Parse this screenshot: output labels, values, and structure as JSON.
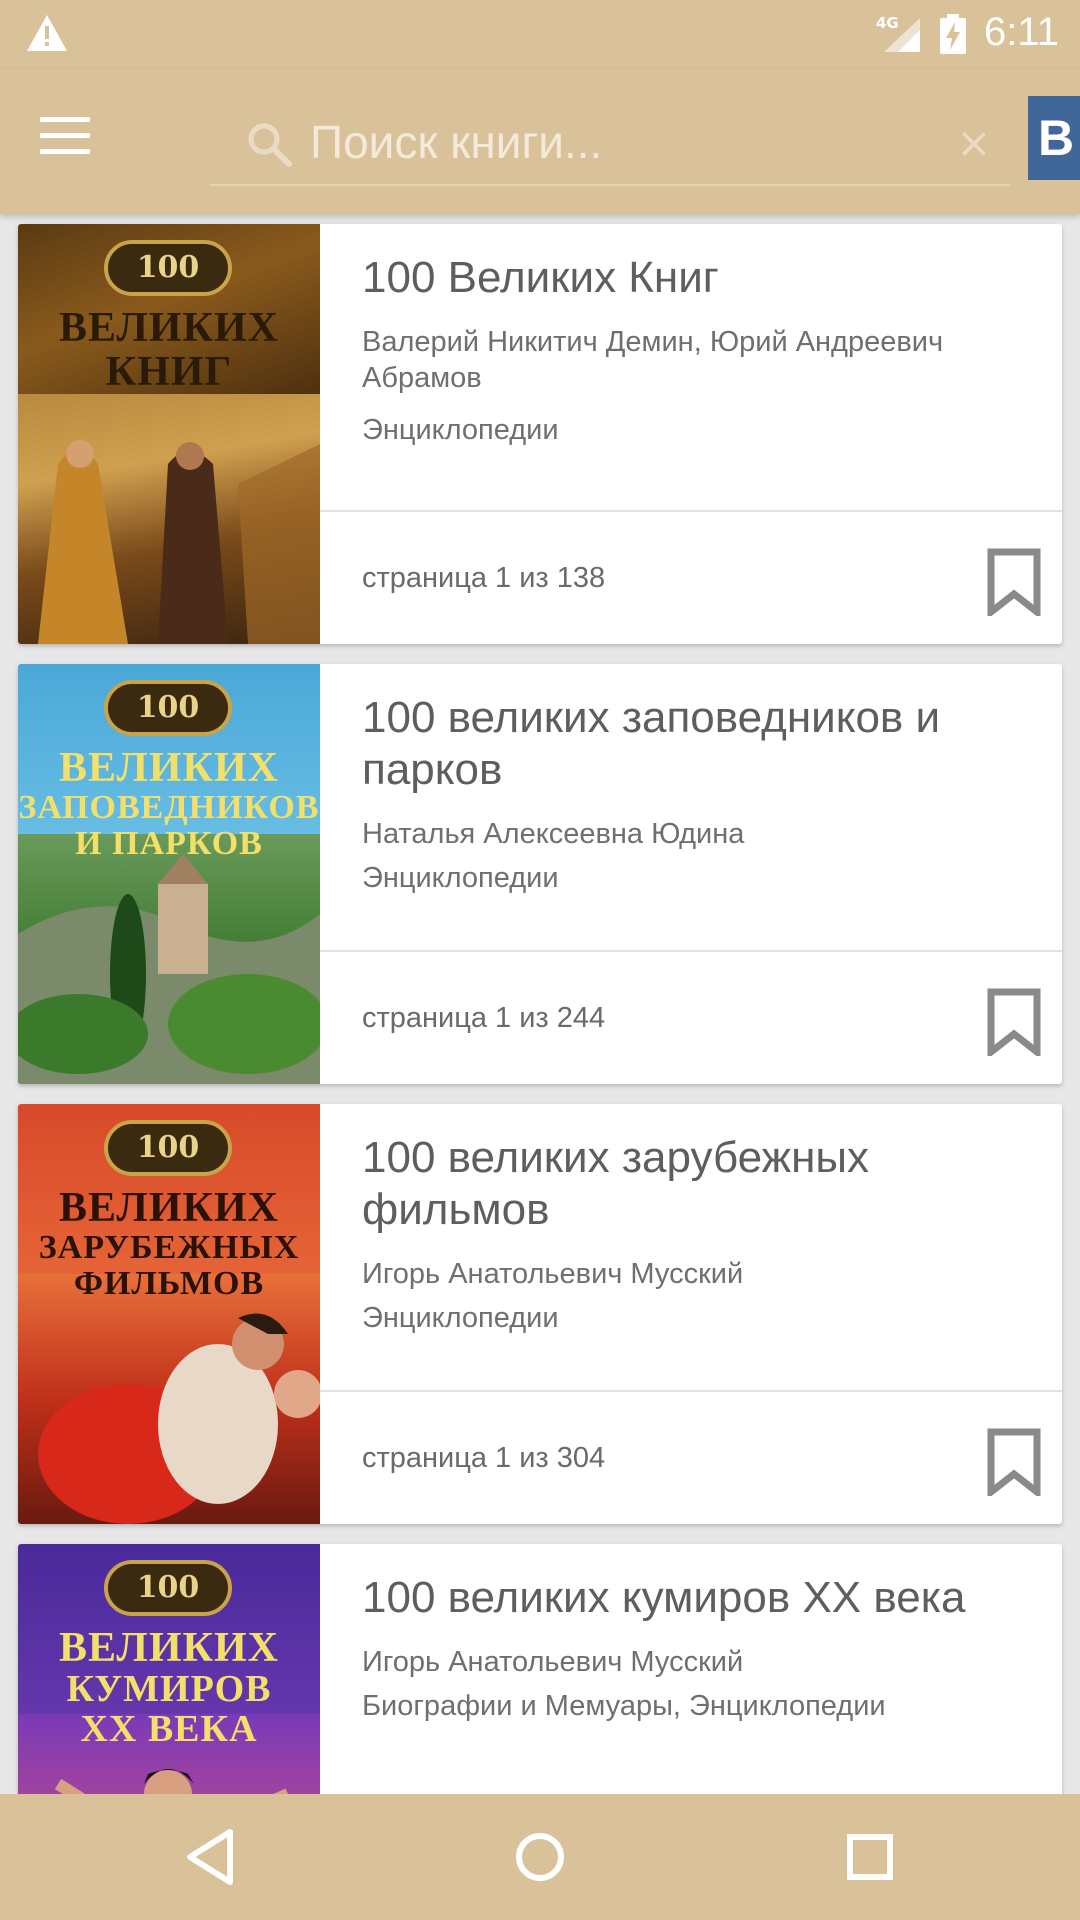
{
  "status_bar": {
    "warning_icon": "warning-triangle-icon",
    "network_label": "4G",
    "signal_icon": "cell-signal-icon",
    "battery_icon": "battery-charging-icon",
    "time": "6:11"
  },
  "app_bar": {
    "menu_icon": "hamburger-menu-icon",
    "search_icon": "search-icon",
    "search_placeholder": "Поиск книги...",
    "search_value": "",
    "clear_icon": "close-icon",
    "clear_glyph": "×",
    "vk_label": "В"
  },
  "books": [
    {
      "title": "100 Великих Книг",
      "authors": "Валерий Никитич Демин, Юрий Андреевич Абрамов",
      "genre": "Энциклопедии",
      "progress": "страница 1 из 138",
      "cover": {
        "badge": "100",
        "title_lines": [
          "ВЕЛИКИХ",
          "КНИГ"
        ]
      }
    },
    {
      "title": "100 великих заповедников и парков",
      "authors": "Наталья Алексеевна Юдина",
      "genre": "Энциклопедии",
      "progress": "страница 1 из 244",
      "cover": {
        "badge": "100",
        "title_lines": [
          "ВЕЛИКИХ",
          "ЗАПОВЕДНИКОВ",
          "И ПАРКОВ"
        ]
      }
    },
    {
      "title": "100 великих зарубежных фильмов",
      "authors": "Игорь Анатольевич Мусский",
      "genre": "Энциклопедии",
      "progress": "страница 1 из 304",
      "cover": {
        "badge": "100",
        "title_lines": [
          "ВЕЛИКИХ",
          "ЗАРУБЕЖНЫХ",
          "ФИЛЬМОВ"
        ]
      }
    },
    {
      "title": "100 великих кумиров XX века",
      "authors": "Игорь Анатольевич Мусский",
      "genre": "Биографии и Мемуары, Энциклопедии",
      "progress": "",
      "cover": {
        "badge": "100",
        "title_lines": [
          "ВЕЛИКИХ",
          "КУМИРОВ",
          "XX ВЕКА"
        ]
      }
    }
  ],
  "nav_bar": {
    "back_icon": "back-triangle-icon",
    "home_icon": "home-circle-icon",
    "recents_icon": "recents-square-icon"
  },
  "colors": {
    "primary": "#d9c19a",
    "vk_blue": "#41669a",
    "text_primary": "#5e5e5e",
    "text_secondary": "#6f6f6f",
    "background": "#e7e7e7"
  }
}
